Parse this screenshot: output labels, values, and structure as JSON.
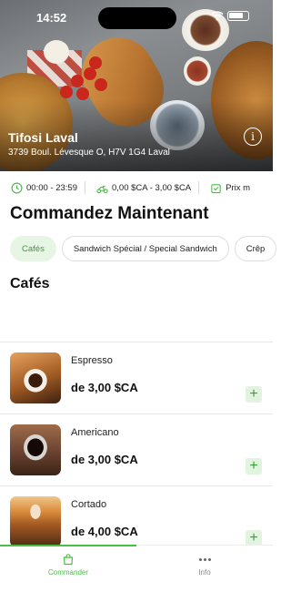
{
  "status_bar": {
    "time": "14:52"
  },
  "store": {
    "name": "Tifosi Laval",
    "address": "3739 Boul. Lévesque O, H7V 1G4 Laval"
  },
  "info_strip": {
    "hours": "00:00 - 23:59",
    "delivery_fee": "0,00 $CA - 3,00 $CA",
    "min_order": "Prix m"
  },
  "page_title": "Commandez Maintenant",
  "categories": [
    "Cafés",
    "Sandwich Spécial / Special Sandwich",
    "Crêp"
  ],
  "active_category": "Cafés",
  "section_title": "Cafés",
  "products": [
    {
      "name": "Espresso",
      "price": "de 3,00 $CA",
      "add": "+"
    },
    {
      "name": "Americano",
      "price": "de 3,00 $CA",
      "add": "+"
    },
    {
      "name": "Cortado",
      "price": "de 4,00 $CA",
      "add": "+"
    }
  ],
  "bottom_nav": [
    {
      "label": "Commander",
      "icon": "bag-icon",
      "active": true
    },
    {
      "label": "Info",
      "icon": "more-dots-icon",
      "active": false
    }
  ],
  "colors": {
    "accent": "#4bbf45",
    "accent_bg": "#e7f6e4"
  }
}
